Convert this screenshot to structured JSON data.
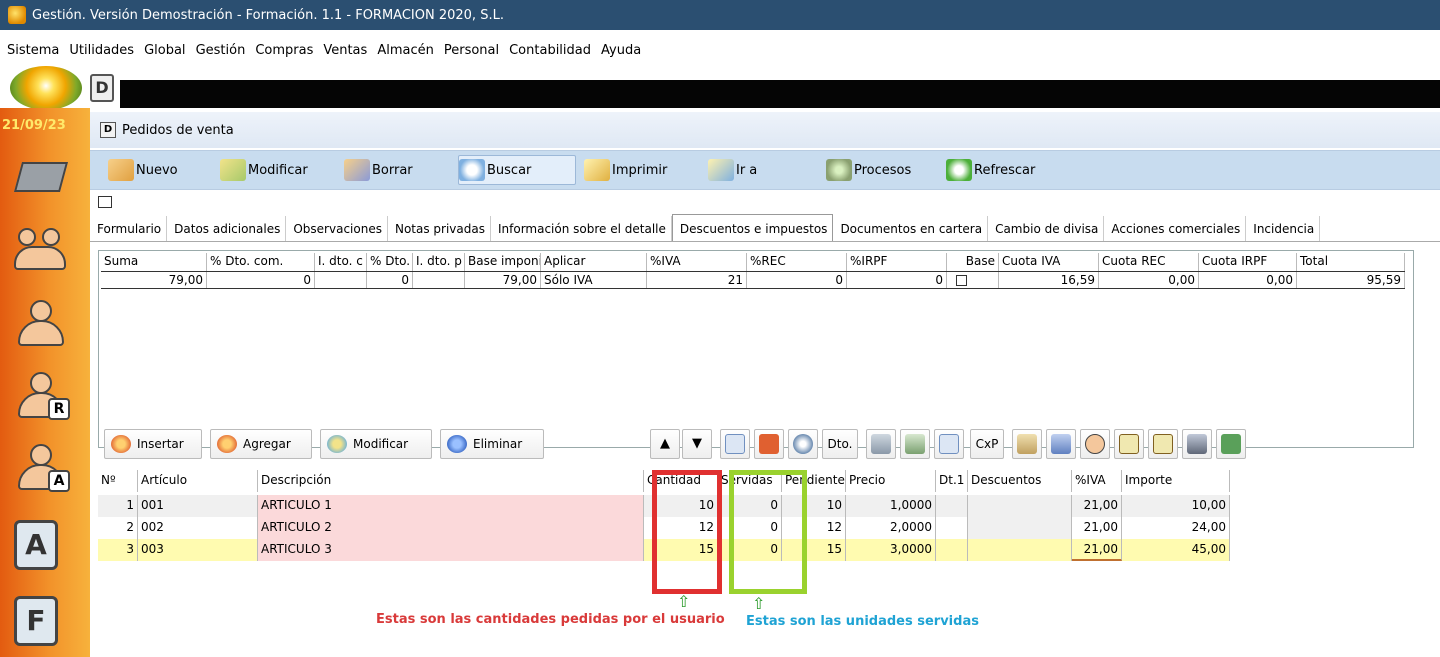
{
  "title": "Gestión. Versión Demostración - Formación. 1.1 - FORMACION 2020, S.L.",
  "menu": [
    "Sistema",
    "Utilidades",
    "Global",
    "Gestión",
    "Compras",
    "Ventas",
    "Almacén",
    "Personal",
    "Contabilidad",
    "Ayuda"
  ],
  "sidebar": {
    "date": "21/09/23",
    "badges": [
      "R",
      "A"
    ],
    "letters": [
      "A",
      "F"
    ]
  },
  "quick_icon": "D",
  "window": {
    "icon": "D",
    "title": "Pedidos de venta"
  },
  "toolbar": [
    {
      "label": "Nuevo",
      "icon": "new-icon"
    },
    {
      "label": "Modificar",
      "icon": "edit-icon"
    },
    {
      "label": "Borrar",
      "icon": "delete-icon"
    },
    {
      "label": "Buscar",
      "icon": "search-icon"
    },
    {
      "label": "Imprimir",
      "icon": "print-icon"
    },
    {
      "label": "Ir a",
      "icon": "goto-icon"
    },
    {
      "label": "Procesos",
      "icon": "gears-icon"
    },
    {
      "label": "Refrescar",
      "icon": "refresh-icon"
    }
  ],
  "tabs": [
    "Formulario",
    "Datos adicionales",
    "Observaciones",
    "Notas privadas",
    "Información sobre el detalle",
    "Descuentos e impuestos",
    "Documentos en cartera",
    "Cambio de divisa",
    "Acciones comerciales",
    "Incidencia"
  ],
  "active_tab": "Descuentos e impuestos",
  "taxes": {
    "headers": [
      "Suma",
      "% Dto. com.",
      "I. dto. c",
      "% Dto.",
      "I. dto. p",
      "Base imponil",
      "Aplicar",
      "%IVA",
      "%REC",
      "%IRPF",
      "Base",
      "Cuota IVA",
      "Cuota REC",
      "Cuota IRPF",
      "Total"
    ],
    "row": [
      "79,00",
      "0",
      "",
      "0",
      "",
      "79,00",
      "Sólo IVA",
      "21",
      "0",
      "0",
      "",
      "16,59",
      "0,00",
      "0,00",
      "95,59"
    ]
  },
  "detail_toolbar": {
    "insertar": "Insertar",
    "agregar": "Agregar",
    "modificar": "Modificar",
    "eliminar": "Eliminar",
    "up": "▲",
    "down": "▼",
    "dto": "Dto.",
    "cxp": "CxP"
  },
  "lines": {
    "headers": [
      "Nº",
      "Artículo",
      "Descripción",
      "Cantidad",
      "Servidas",
      "Pendientes",
      "Precio",
      "Dt.1",
      "Descuentos",
      "%IVA",
      "Importe"
    ],
    "rows": [
      [
        "1",
        "001",
        "ARTICULO 1",
        "10",
        "0",
        "10",
        "1,0000",
        "",
        "",
        "21,00",
        "10,00"
      ],
      [
        "2",
        "002",
        "ARTICULO 2",
        "12",
        "0",
        "12",
        "2,0000",
        "",
        "",
        "21,00",
        "24,00"
      ],
      [
        "3",
        "003",
        "ARTICULO 3",
        "15",
        "0",
        "15",
        "3,0000",
        "",
        "",
        "21,00",
        "45,00"
      ]
    ]
  },
  "annotations": {
    "arrow": "⇧",
    "cantidad": "Estas son las cantidades pedidas por el usuario",
    "servidas": "Estas son las unidades servidas"
  },
  "colors": {
    "titlebar": "#2b4f71",
    "toolbar": "#c8dcef",
    "red_box": "#e03030",
    "green_box": "#9ad22e",
    "pink_row": "#fbd9da",
    "yellow_row": "#fffbb0"
  }
}
